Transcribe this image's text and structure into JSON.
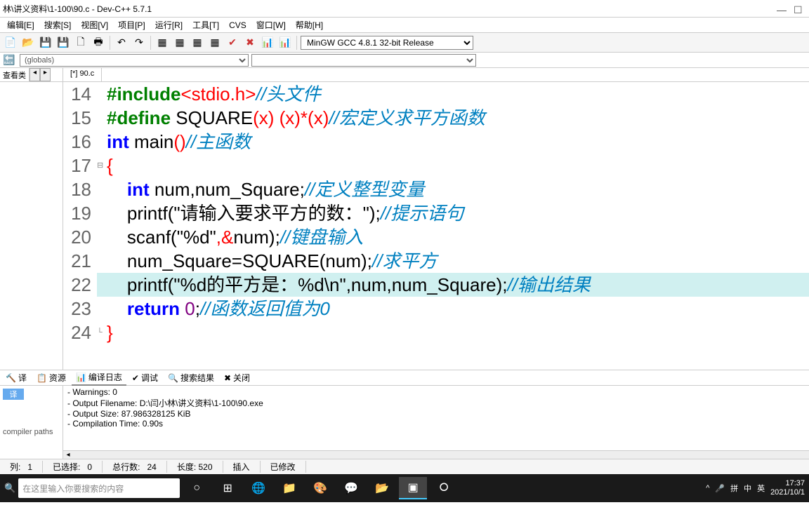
{
  "title": "林\\讲义资料\\1-100\\90.c - Dev-C++ 5.7.1",
  "menu": [
    "编辑[E]",
    "搜索[S]",
    "视图[V]",
    "项目[P]",
    "运行[R]",
    "工具[T]",
    "CVS",
    "窗口[W]",
    "帮助[H]"
  ],
  "compiler": "MinGW GCC 4.8.1 32-bit Release",
  "scope": "(globals)",
  "left_tab": "查看类",
  "doc_tab": "[*] 90.c",
  "bottom_tabs": {
    "res": "资源",
    "log": "编译日志",
    "dbg": "调试",
    "find": "搜索结果",
    "close": "关闭"
  },
  "left_labels": {
    "compile": "译",
    "paths": "compiler paths"
  },
  "log": [
    "- Warnings: 0",
    "- Output Filename: D:\\闫小林\\讲义资料\\1-100\\90.exe",
    "- Output Size: 87.986328125 KiB",
    "- Compilation Time: 0.90s"
  ],
  "status": {
    "col_l": "列:",
    "col_v": "1",
    "sel_l": "已选择:",
    "sel_v": "0",
    "tot_l": "总行数:",
    "tot_v": "24",
    "len_l": "长度:",
    "len_v": "520",
    "ins": "插入",
    "mod": "已修改"
  },
  "search_ph": "在这里输入你要搜索的内容",
  "time": "17:37",
  "date": "2021/10/1",
  "ime": {
    "pin": "拼",
    "ch": "中",
    "en": "英"
  },
  "code": {
    "l14": {
      "inc": "#include",
      "hdr": "<stdio.h>",
      "cmt": "//头文件"
    },
    "l15": {
      "def": "#define",
      "name": " SQUARE",
      "args": "(x) (x)*(x)",
      "cmt": "//宏定义求平方函数"
    },
    "l16": {
      "kw": "int",
      "main": " main",
      "par": "()",
      "cmt": "//主函数"
    },
    "l17": "{",
    "l18": {
      "kw": "int",
      "vars": " num,num_Square;",
      "cmt": "//定义整型变量"
    },
    "l19": {
      "fn": "printf(",
      "str": "\"请输入要求平方的数：\"",
      ");": ");",
      "cmt": "//提示语句"
    },
    "l20": {
      "fn": "scanf(",
      "str": "\"%d\"",
      "amp": ",&",
      "v": "num);",
      "cmt": "//键盘输入"
    },
    "l21": {
      "a": "num_Square=SQUARE(num);",
      "cmt": "//求平方"
    },
    "l22": {
      "fn": "printf(",
      "str": "\"%d的平方是：%d\\n\"",
      "rest": ",num,num_Square);",
      "cmt": "//输出结果"
    },
    "l23": {
      "kw": "return ",
      "num": "0",
      "semi": ";",
      "cmt": "//函数返回值为0"
    },
    "l24": "}"
  }
}
